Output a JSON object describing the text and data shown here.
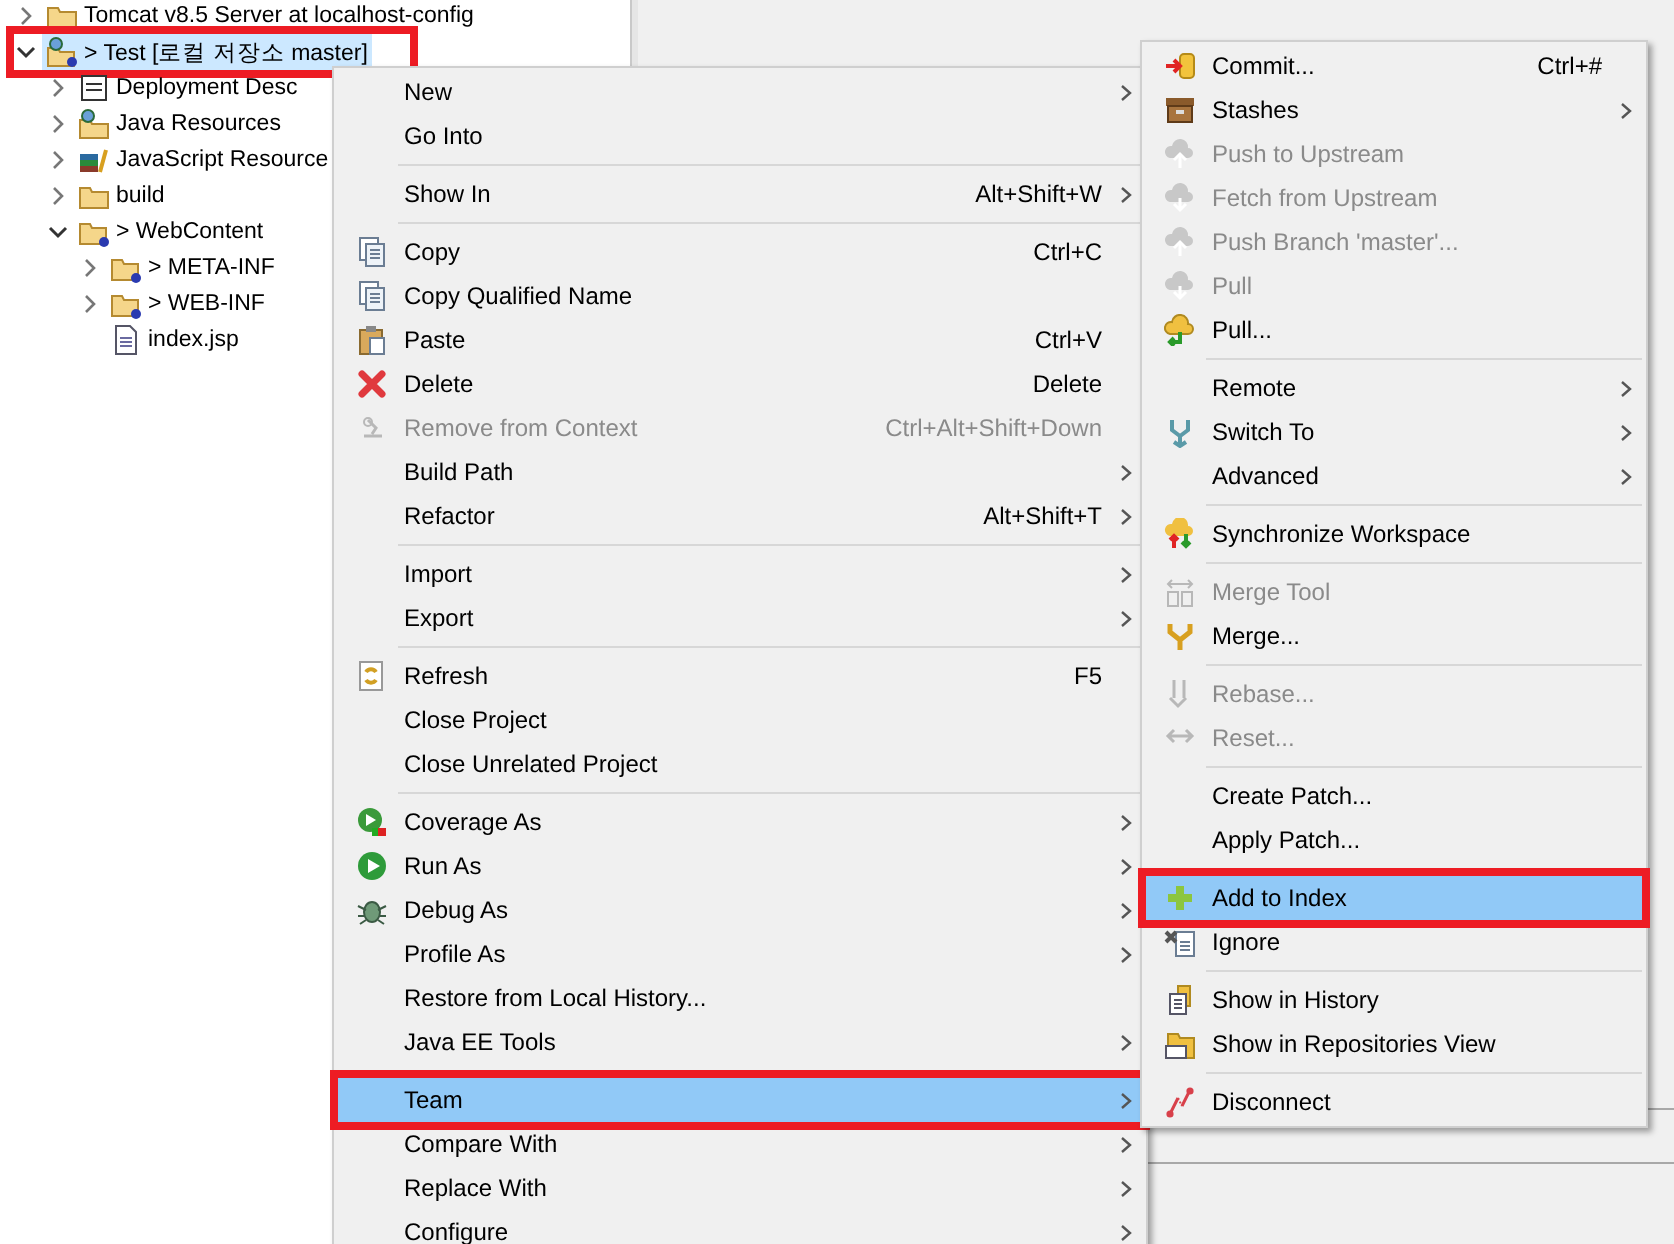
{
  "tree": [
    {
      "label": "Tomcat v8.5 Server at localhost-config",
      "kind": "folder",
      "expanded": false,
      "selected": false,
      "highlighted": false
    },
    {
      "label": "> Test [로컬 저장소 master]",
      "kind": "project",
      "expanded": true,
      "selected": true,
      "highlighted": true,
      "children": [
        {
          "label": "Deployment Desc",
          "kind": "descriptor",
          "expanded": false,
          "selected": false,
          "highlighted": false
        },
        {
          "label": "Java Resources",
          "kind": "java-resources",
          "expanded": false,
          "selected": false,
          "highlighted": false
        },
        {
          "label": "JavaScript Resource",
          "kind": "js-resources",
          "expanded": false,
          "selected": false,
          "highlighted": false
        },
        {
          "label": "build",
          "kind": "folder",
          "expanded": false,
          "selected": false,
          "highlighted": false
        },
        {
          "label": "> WebContent",
          "kind": "folder-untracked",
          "expanded": true,
          "selected": false,
          "highlighted": false,
          "children": [
            {
              "label": "> META-INF",
              "kind": "folder-untracked",
              "expanded": false,
              "selected": false,
              "highlighted": false
            },
            {
              "label": "> WEB-INF",
              "kind": "folder-untracked",
              "expanded": false,
              "selected": false,
              "highlighted": false
            },
            {
              "label": "index.jsp",
              "kind": "file",
              "selected": false,
              "highlighted": false
            }
          ]
        }
      ]
    }
  ],
  "context_menu": {
    "items": [
      {
        "kind": "plain",
        "label": "New",
        "submenu": true,
        "disabled": false,
        "selected": false,
        "highlighted": false
      },
      {
        "kind": "plain",
        "label": "Go Into",
        "submenu": false,
        "disabled": false,
        "selected": false,
        "highlighted": false
      },
      {
        "kind": "separator"
      },
      {
        "kind": "plain",
        "label": "Show In",
        "shortcut": "Alt+Shift+W",
        "submenu": true,
        "disabled": false,
        "selected": false,
        "highlighted": false
      },
      {
        "kind": "separator"
      },
      {
        "kind": "copy",
        "label": "Copy",
        "shortcut": "Ctrl+C",
        "submenu": false,
        "disabled": false,
        "selected": false,
        "highlighted": false
      },
      {
        "kind": "copy",
        "label": "Copy Qualified Name",
        "submenu": false,
        "disabled": false,
        "selected": false,
        "highlighted": false
      },
      {
        "kind": "paste",
        "label": "Paste",
        "shortcut": "Ctrl+V",
        "submenu": false,
        "disabled": false,
        "selected": false,
        "highlighted": false
      },
      {
        "kind": "delete",
        "label": "Delete",
        "shortcut": "Delete",
        "submenu": false,
        "disabled": false,
        "selected": false,
        "highlighted": false
      },
      {
        "kind": "remove-context",
        "label": "Remove from Context",
        "shortcut": "Ctrl+Alt+Shift+Down",
        "submenu": false,
        "disabled": true,
        "selected": false,
        "highlighted": false
      },
      {
        "kind": "plain",
        "label": "Build Path",
        "submenu": true,
        "disabled": false,
        "selected": false,
        "highlighted": false
      },
      {
        "kind": "plain",
        "label": "Refactor",
        "shortcut": "Alt+Shift+T",
        "submenu": true,
        "disabled": false,
        "selected": false,
        "highlighted": false
      },
      {
        "kind": "separator"
      },
      {
        "kind": "plain",
        "label": "Import",
        "submenu": true,
        "disabled": false,
        "selected": false,
        "highlighted": false
      },
      {
        "kind": "plain",
        "label": "Export",
        "submenu": true,
        "disabled": false,
        "selected": false,
        "highlighted": false
      },
      {
        "kind": "separator"
      },
      {
        "kind": "refresh",
        "label": "Refresh",
        "shortcut": "F5",
        "submenu": false,
        "disabled": false,
        "selected": false,
        "highlighted": false
      },
      {
        "kind": "plain",
        "label": "Close Project",
        "submenu": false,
        "disabled": false,
        "selected": false,
        "highlighted": false
      },
      {
        "kind": "plain",
        "label": "Close Unrelated Project",
        "submenu": false,
        "disabled": false,
        "selected": false,
        "highlighted": false
      },
      {
        "kind": "separator"
      },
      {
        "kind": "coverage",
        "label": "Coverage As",
        "submenu": true,
        "disabled": false,
        "selected": false,
        "highlighted": false
      },
      {
        "kind": "run",
        "label": "Run As",
        "submenu": true,
        "disabled": false,
        "selected": false,
        "highlighted": false
      },
      {
        "kind": "debug",
        "label": "Debug As",
        "submenu": true,
        "disabled": false,
        "selected": false,
        "highlighted": false
      },
      {
        "kind": "plain",
        "label": "Profile As",
        "submenu": true,
        "disabled": false,
        "selected": false,
        "highlighted": false
      },
      {
        "kind": "plain",
        "label": "Restore from Local History...",
        "submenu": false,
        "disabled": false,
        "selected": false,
        "highlighted": false
      },
      {
        "kind": "plain",
        "label": "Java EE Tools",
        "submenu": true,
        "disabled": false,
        "selected": false,
        "highlighted": false
      },
      {
        "kind": "separator"
      },
      {
        "kind": "plain",
        "label": "Team",
        "submenu": true,
        "disabled": false,
        "selected": true,
        "highlighted": true
      },
      {
        "kind": "plain",
        "label": "Compare With",
        "submenu": true,
        "disabled": false,
        "selected": false,
        "highlighted": false
      },
      {
        "kind": "plain",
        "label": "Replace With",
        "submenu": true,
        "disabled": false,
        "selected": false,
        "highlighted": false
      },
      {
        "kind": "plain",
        "label": "Configure",
        "submenu": true,
        "disabled": false,
        "selected": false,
        "highlighted": false
      }
    ]
  },
  "team_submenu": {
    "items": [
      {
        "kind": "commit",
        "label": "Commit...",
        "shortcut": "Ctrl+#",
        "submenu": false,
        "disabled": false,
        "selected": false,
        "highlighted": false
      },
      {
        "kind": "stash",
        "label": "Stashes",
        "submenu": true,
        "disabled": false,
        "selected": false,
        "highlighted": false
      },
      {
        "kind": "cloud-up",
        "label": "Push to Upstream",
        "submenu": false,
        "disabled": true,
        "selected": false,
        "highlighted": false
      },
      {
        "kind": "cloud-down",
        "label": "Fetch from Upstream",
        "submenu": false,
        "disabled": true,
        "selected": false,
        "highlighted": false
      },
      {
        "kind": "cloud-up",
        "label": "Push Branch 'master'...",
        "submenu": false,
        "disabled": true,
        "selected": false,
        "highlighted": false
      },
      {
        "kind": "cloud-down",
        "label": "Pull",
        "submenu": false,
        "disabled": true,
        "selected": false,
        "highlighted": false
      },
      {
        "kind": "pull",
        "label": "Pull...",
        "submenu": false,
        "disabled": false,
        "selected": false,
        "highlighted": false
      },
      {
        "kind": "separator"
      },
      {
        "kind": "plain",
        "label": "Remote",
        "submenu": true,
        "disabled": false,
        "selected": false,
        "highlighted": false
      },
      {
        "kind": "switch",
        "label": "Switch To",
        "submenu": true,
        "disabled": false,
        "selected": false,
        "highlighted": false
      },
      {
        "kind": "plain",
        "label": "Advanced",
        "submenu": true,
        "disabled": false,
        "selected": false,
        "highlighted": false
      },
      {
        "kind": "separator"
      },
      {
        "kind": "sync",
        "label": "Synchronize Workspace",
        "submenu": false,
        "disabled": false,
        "selected": false,
        "highlighted": false
      },
      {
        "kind": "separator"
      },
      {
        "kind": "merge-tool",
        "label": "Merge Tool",
        "submenu": false,
        "disabled": true,
        "selected": false,
        "highlighted": false
      },
      {
        "kind": "merge",
        "label": "Merge...",
        "submenu": false,
        "disabled": false,
        "selected": false,
        "highlighted": false
      },
      {
        "kind": "separator"
      },
      {
        "kind": "rebase",
        "label": "Rebase...",
        "submenu": false,
        "disabled": true,
        "selected": false,
        "highlighted": false
      },
      {
        "kind": "reset",
        "label": "Reset...",
        "submenu": false,
        "disabled": true,
        "selected": false,
        "highlighted": false
      },
      {
        "kind": "separator"
      },
      {
        "kind": "plain",
        "label": "Create Patch...",
        "submenu": false,
        "disabled": false,
        "selected": false,
        "highlighted": false
      },
      {
        "kind": "plain",
        "label": "Apply Patch...",
        "submenu": false,
        "disabled": false,
        "selected": false,
        "highlighted": false
      },
      {
        "kind": "separator"
      },
      {
        "kind": "add",
        "label": "Add to Index",
        "submenu": false,
        "disabled": false,
        "selected": true,
        "highlighted": true
      },
      {
        "kind": "ignore",
        "label": "Ignore",
        "submenu": false,
        "disabled": false,
        "selected": false,
        "highlighted": false
      },
      {
        "kind": "separator"
      },
      {
        "kind": "history",
        "label": "Show in History",
        "submenu": false,
        "disabled": false,
        "selected": false,
        "highlighted": false
      },
      {
        "kind": "repo",
        "label": "Show in Repositories View",
        "submenu": false,
        "disabled": false,
        "selected": false,
        "highlighted": false
      },
      {
        "kind": "separator"
      },
      {
        "kind": "disconnect",
        "label": "Disconnect",
        "submenu": false,
        "disabled": false,
        "selected": false,
        "highlighted": false
      }
    ]
  }
}
